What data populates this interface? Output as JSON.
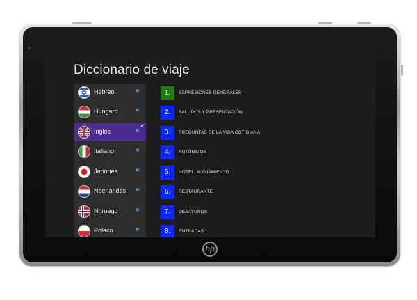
{
  "app": {
    "title": "Diccionario de viaje"
  },
  "device": {
    "logo_text": "hp"
  },
  "languages": [
    {
      "label": "Hebreo",
      "flag": "israel-flag-icon",
      "selected": false
    },
    {
      "label": "Húngaro",
      "flag": "hungary-flag-icon",
      "selected": false
    },
    {
      "label": "Inglés",
      "flag": "uk-flag-icon",
      "selected": true
    },
    {
      "label": "Italiano",
      "flag": "italy-flag-icon",
      "selected": false
    },
    {
      "label": "Japonés",
      "flag": "japan-flag-icon",
      "selected": false
    },
    {
      "label": "Neerlandés",
      "flag": "netherlands-flag-icon",
      "selected": false
    },
    {
      "label": "Noruego",
      "flag": "norway-flag-icon",
      "selected": false
    },
    {
      "label": "Polaco",
      "flag": "poland-flag-icon",
      "selected": false
    }
  ],
  "topics": [
    {
      "number": "1.",
      "label": "EXPRESIONES GENERALES"
    },
    {
      "number": "2.",
      "label": "SALUDOS Y PRESENTACIÓN"
    },
    {
      "number": "3.",
      "label": "PREGUNTAS DE LA VIDA COTIDIANA"
    },
    {
      "number": "4.",
      "label": "ANTÓNIMOS"
    },
    {
      "number": "5.",
      "label": "HOTEL, ALOJAMIENTO"
    },
    {
      "number": "6.",
      "label": "RESTAURANTE"
    },
    {
      "number": "7.",
      "label": "DESAYUNOS"
    },
    {
      "number": "8.",
      "label": "ENTRADAS"
    }
  ],
  "colors": {
    "selected_language": "#4e2b8f",
    "topic_number": "#0c28ff",
    "active_topic_number": "#1d7a12",
    "speaker": "#4aa3e8"
  }
}
